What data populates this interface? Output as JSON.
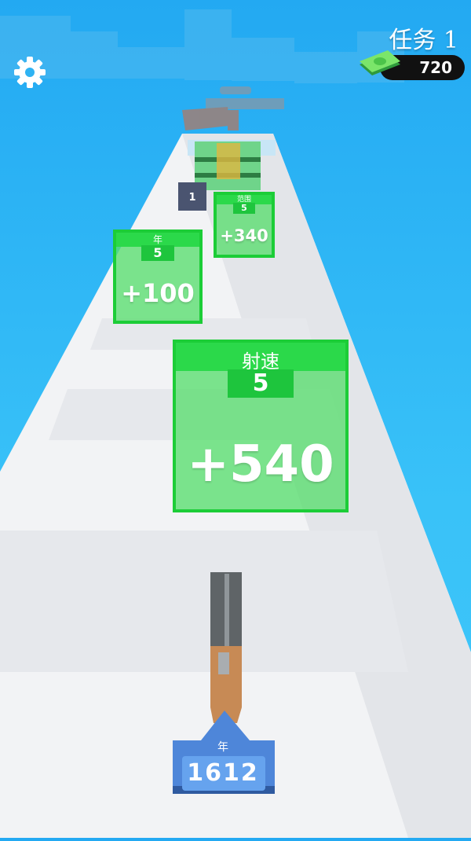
{
  "hud": {
    "settings_icon": "gear-icon",
    "mission_label": "任务 1",
    "money_icon": "cash-icon",
    "money_amount": "720"
  },
  "gates": [
    {
      "stat": "射速",
      "value": "5",
      "bonus": "+540"
    },
    {
      "stat": "年",
      "value": "5",
      "bonus": "+100"
    },
    {
      "stat": "范围",
      "value": "5",
      "bonus": "+340"
    }
  ],
  "far_block_number": "1",
  "player": {
    "stat_label": "年",
    "year_value": "1612"
  },
  "colors": {
    "sky": "#23a9f2",
    "track": "#f2f3f5",
    "gate_green": "#2bd94a",
    "badge_blue": "#3f7fd8"
  }
}
